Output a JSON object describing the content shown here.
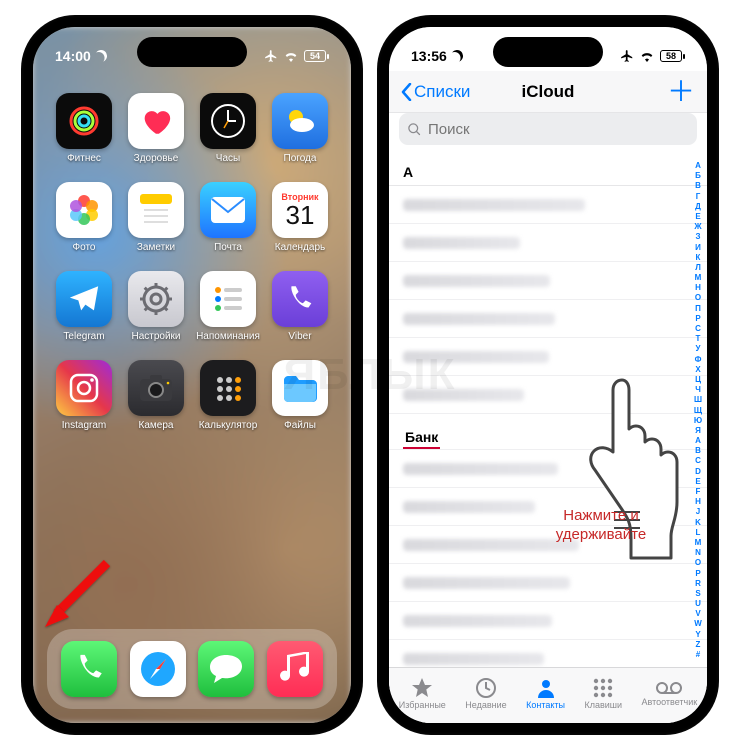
{
  "watermark": "ЯБЛЫК",
  "left": {
    "status": {
      "time": "14:00",
      "battery": "54"
    },
    "apps": [
      {
        "name": "Фитнес",
        "icon": "fitness",
        "bg": "#0b0b0b",
        "fg": "#ff3b30"
      },
      {
        "name": "Здоровье",
        "icon": "health",
        "bg": "#ffffff",
        "fg": "#ff2d55"
      },
      {
        "name": "Часы",
        "icon": "clock",
        "bg": "#0b0b0b",
        "fg": "#ffffff"
      },
      {
        "name": "Погода",
        "icon": "weather",
        "bg": "linear-gradient(180deg,#4aa3ff,#1f6fe0)",
        "fg": "#ffd60a"
      },
      {
        "name": "Фото",
        "icon": "photos",
        "bg": "#ffffff",
        "fg": ""
      },
      {
        "name": "Заметки",
        "icon": "notes",
        "bg": "#ffffff",
        "fg": "#ffcc00"
      },
      {
        "name": "Почта",
        "icon": "mail",
        "bg": "linear-gradient(180deg,#3ad0ff,#1e74ff)",
        "fg": "#ffffff"
      },
      {
        "name": "Календарь",
        "icon": "calendar",
        "bg": "#ffffff",
        "fg": "#ff3b30",
        "day": "Вторник",
        "date": "31"
      },
      {
        "name": "Telegram",
        "icon": "telegram",
        "bg": "linear-gradient(180deg,#2fb3ff,#1477d3)",
        "fg": "#ffffff"
      },
      {
        "name": "Настройки",
        "icon": "settings",
        "bg": "linear-gradient(180deg,#e9e9ed,#c8c8cf)",
        "fg": "#6c6c72"
      },
      {
        "name": "Напоминания",
        "icon": "reminders",
        "bg": "#ffffff",
        "fg": "#555"
      },
      {
        "name": "Viber",
        "icon": "viber",
        "bg": "linear-gradient(180deg,#8f5ff0,#6b3fd8)",
        "fg": "#ffffff"
      },
      {
        "name": "Instagram",
        "icon": "instagram",
        "bg": "linear-gradient(45deg,#fdcb42,#e6374a,#9f2bd8)",
        "fg": "#ffffff"
      },
      {
        "name": "Камера",
        "icon": "camera",
        "bg": "linear-gradient(180deg,#4a4a4f,#2b2b2f)",
        "fg": "#d0d0d4"
      },
      {
        "name": "Калькулятор",
        "icon": "calc",
        "bg": "#1c1c1e",
        "fg": "#ff9f0a"
      },
      {
        "name": "Файлы",
        "icon": "files",
        "bg": "#ffffff",
        "fg": "#1e9cff"
      }
    ],
    "dock": [
      {
        "name": "Телефон",
        "icon": "phone",
        "bg": "linear-gradient(180deg,#5df777,#1fbf3d)"
      },
      {
        "name": "Safari",
        "icon": "safari",
        "bg": "#ffffff"
      },
      {
        "name": "Сообщения",
        "icon": "messages",
        "bg": "linear-gradient(180deg,#5df777,#1fbf3d)"
      },
      {
        "name": "Музыка",
        "icon": "music",
        "bg": "linear-gradient(180deg,#ff5a72,#ff2d55)"
      }
    ]
  },
  "right": {
    "status": {
      "time": "13:56",
      "battery": "58"
    },
    "nav": {
      "back": "Списки",
      "title": "iCloud",
      "add": "＋"
    },
    "search": {
      "placeholder": "Поиск"
    },
    "sections": {
      "a_count": 6,
      "b_label": "Банк",
      "b_count": 6
    },
    "index": [
      "А",
      "Б",
      "В",
      "Г",
      "Д",
      "Е",
      "Ж",
      "З",
      "И",
      "К",
      "Л",
      "М",
      "Н",
      "О",
      "П",
      "Р",
      "С",
      "Т",
      "У",
      "Ф",
      "Х",
      "Ц",
      "Ч",
      "Ш",
      "Щ",
      "Ю",
      "Я",
      "A",
      "B",
      "C",
      "D",
      "E",
      "F",
      "H",
      "J",
      "K",
      "L",
      "M",
      "N",
      "O",
      "P",
      "R",
      "S",
      "U",
      "V",
      "W",
      "Y",
      "Z",
      "#"
    ],
    "tabs": [
      {
        "label": "Избранные",
        "icon": "star"
      },
      {
        "label": "Недавние",
        "icon": "clock2"
      },
      {
        "label": "Контакты",
        "icon": "person",
        "active": true
      },
      {
        "label": "Клавиши",
        "icon": "keypad"
      },
      {
        "label": "Автоответчик",
        "icon": "voicemail"
      }
    ],
    "hint": "Нажмите и удерживайте"
  }
}
